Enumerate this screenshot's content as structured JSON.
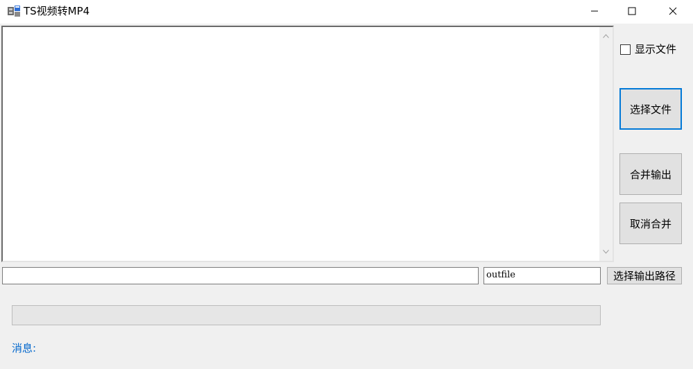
{
  "window": {
    "title": "TS视频转MP4",
    "controls": {
      "minimize": "minimize-icon",
      "maximize": "maximize-icon",
      "close": "close-icon"
    }
  },
  "file_list": {
    "items": []
  },
  "options": {
    "show_files_label": "显示文件",
    "show_files_checked": false
  },
  "buttons": {
    "select_files": "选择文件",
    "merge_output": "合并输出",
    "cancel_merge": "取消合并",
    "select_output_path": "选择输出路径"
  },
  "inputs": {
    "output_path_value": "",
    "output_filename_value": "outfile"
  },
  "progress": {
    "value": 0
  },
  "status": {
    "message_label": "消息:"
  },
  "colors": {
    "focus_border": "#0078d7",
    "message_text": "#0066cc",
    "window_bg": "#f0f0f0"
  }
}
